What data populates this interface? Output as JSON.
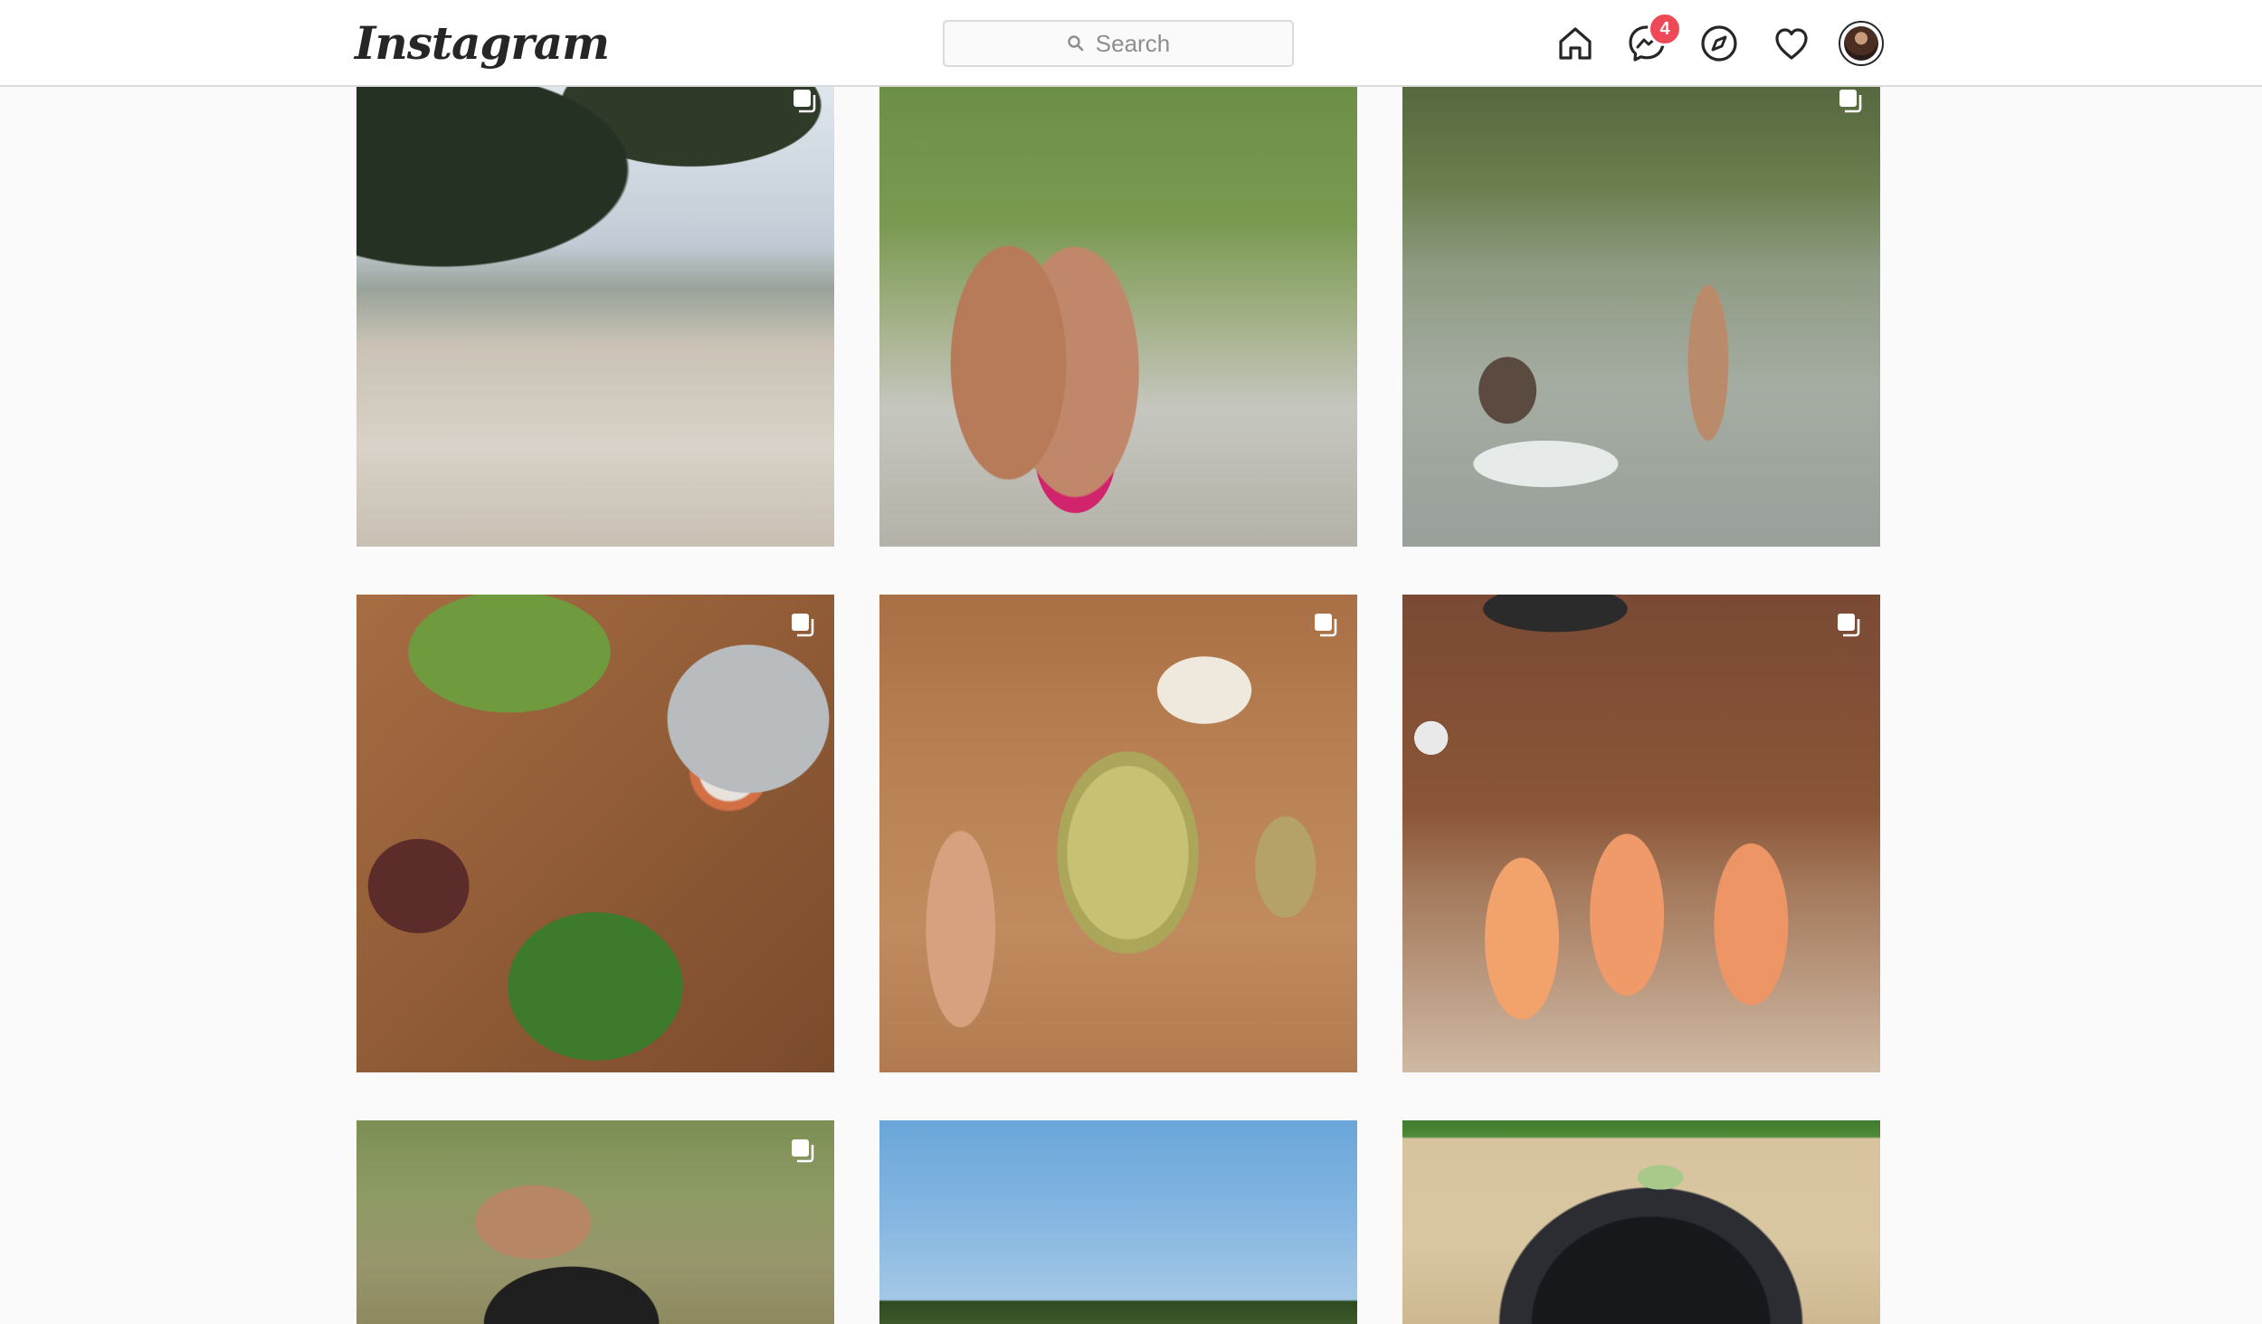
{
  "app": {
    "logo_text": "Instagram"
  },
  "search": {
    "placeholder": "Search"
  },
  "nav": {
    "icons": [
      "home-icon",
      "messenger-icon",
      "explore-compass-icon",
      "activity-heart-icon"
    ],
    "messages_badge": "4"
  },
  "colors": {
    "header_bg": "#ffffff",
    "border": "#dbdbdb",
    "page_bg": "#fafafa",
    "badge": "#ed4956",
    "icon": "#262626"
  },
  "posts": [
    {
      "row": 1,
      "col": 1,
      "multi_image": true
    },
    {
      "row": 1,
      "col": 2,
      "multi_image": false
    },
    {
      "row": 1,
      "col": 3,
      "multi_image": true
    },
    {
      "row": 2,
      "col": 1,
      "multi_image": true
    },
    {
      "row": 2,
      "col": 2,
      "multi_image": true
    },
    {
      "row": 2,
      "col": 3,
      "multi_image": true
    },
    {
      "row": 3,
      "col": 1,
      "multi_image": true
    },
    {
      "row": 3,
      "col": 2,
      "multi_image": false
    },
    {
      "row": 3,
      "col": 3,
      "multi_image": false
    }
  ]
}
